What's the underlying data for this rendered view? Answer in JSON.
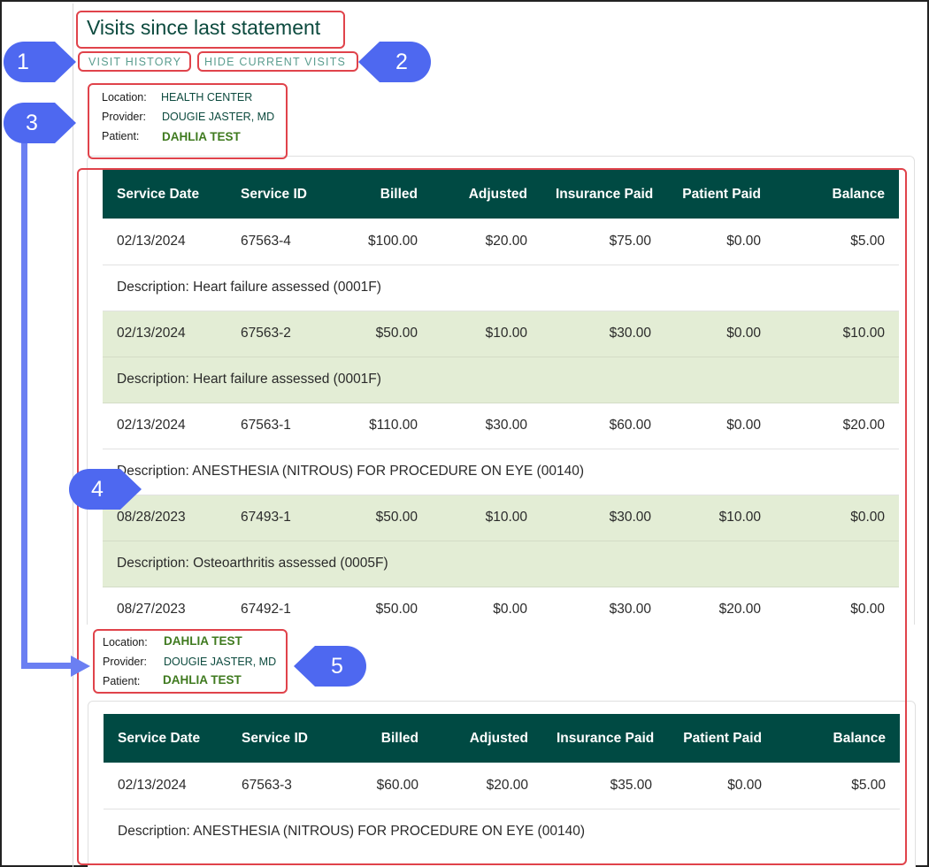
{
  "header": {
    "title": "Visits since last statement",
    "links": {
      "visit_history": "VISIT HISTORY",
      "hide_current_visits": "HIDE CURRENT VISITS"
    }
  },
  "columns": [
    "Service Date",
    "Service ID",
    "Billed",
    "Adjusted",
    "Insurance Paid",
    "Patient Paid",
    "Balance"
  ],
  "group1": {
    "info": {
      "location_label": "Location:",
      "location": "HEALTH CENTER",
      "provider_label": "Provider:",
      "provider": "DOUGIE JASTER, MD",
      "patient_label": "Patient:",
      "patient": "DAHLIA TEST"
    },
    "visits": [
      {
        "date": "02/13/2024",
        "id": "67563-4",
        "billed": "$100.00",
        "adjusted": "$20.00",
        "ins_paid": "$75.00",
        "pt_paid": "$0.00",
        "balance": "$5.00",
        "description": "Description: Heart failure assessed (0001F)"
      },
      {
        "date": "02/13/2024",
        "id": "67563-2",
        "billed": "$50.00",
        "adjusted": "$10.00",
        "ins_paid": "$30.00",
        "pt_paid": "$0.00",
        "balance": "$10.00",
        "description": "Description: Heart failure assessed (0001F)"
      },
      {
        "date": "02/13/2024",
        "id": "67563-1",
        "billed": "$110.00",
        "adjusted": "$30.00",
        "ins_paid": "$60.00",
        "pt_paid": "$0.00",
        "balance": "$20.00",
        "description": "Description: ANESTHESIA (NITROUS) FOR PROCEDURE ON EYE (00140)"
      },
      {
        "date": "08/28/2023",
        "id": "67493-1",
        "billed": "$50.00",
        "adjusted": "$10.00",
        "ins_paid": "$30.00",
        "pt_paid": "$10.00",
        "balance": "$0.00",
        "description": "Description: Osteoarthritis assessed (0005F)"
      },
      {
        "date": "08/27/2023",
        "id": "67492-1",
        "billed": "$50.00",
        "adjusted": "$0.00",
        "ins_paid": "$30.00",
        "pt_paid": "$20.00",
        "balance": "$0.00"
      }
    ]
  },
  "group2": {
    "info": {
      "location_label": "Location:",
      "location": "DAHLIA TEST",
      "provider_label": "Provider:",
      "provider": "DOUGIE JASTER, MD",
      "patient_label": "Patient:",
      "patient": "DAHLIA TEST"
    },
    "visits": [
      {
        "date": "02/13/2024",
        "id": "67563-3",
        "billed": "$60.00",
        "adjusted": "$20.00",
        "ins_paid": "$35.00",
        "pt_paid": "$0.00",
        "balance": "$5.00",
        "description": "Description: ANESTHESIA (NITROUS) FOR PROCEDURE ON EYE (00140)"
      }
    ]
  },
  "callouts": [
    "1",
    "2",
    "3",
    "4",
    "5"
  ],
  "colors": {
    "header_bg": "#004a43",
    "shaded_row": "#e3edd5",
    "highlight": "#e0434b",
    "callout": "#4e68f0",
    "link": "#5c9e90",
    "green_value": "#3f7a1f"
  }
}
